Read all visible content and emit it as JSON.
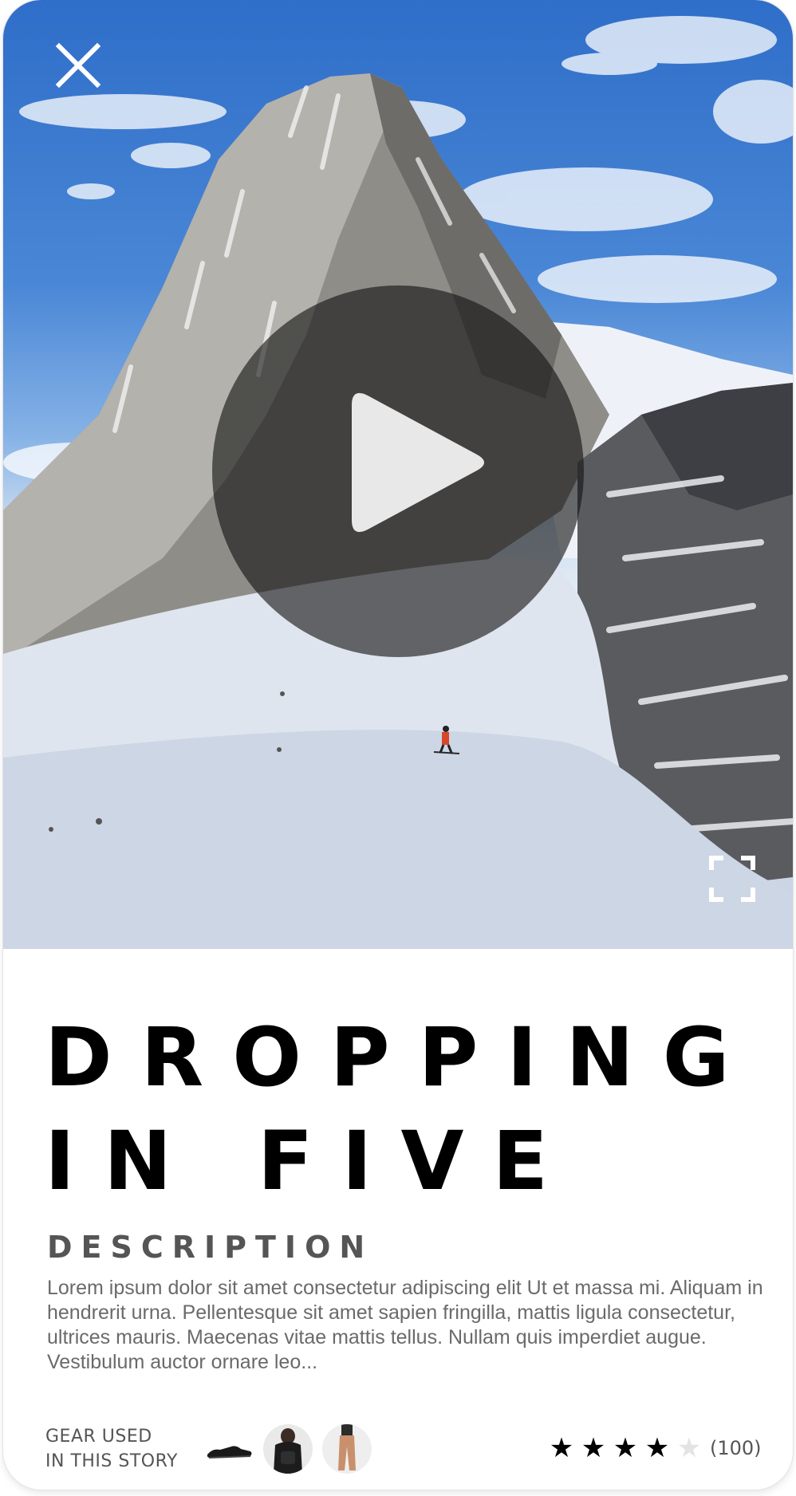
{
  "video": {
    "title_lines": [
      "DROPPING",
      "IN FIVE"
    ],
    "icons": {
      "close": "close-icon",
      "play": "play-icon",
      "fullscreen": "fullscreen-icon"
    }
  },
  "description": {
    "heading": "DESCRIPTION",
    "text": "Lorem ipsum dolor sit amet consectetur adipiscing elit Ut et massa mi. Aliquam in hendrerit urna. Pellentesque sit amet sapien fringilla, mattis ligula consectetur, ultrices mauris. Maecenas vitae mattis tellus. Nullam quis imperdiet augue. Vestibulum auctor ornare leo..."
  },
  "gear": {
    "label_lines": [
      "GEAR USED",
      "IN THIS STORY"
    ],
    "items": [
      {
        "icon": "shoe-icon"
      },
      {
        "icon": "backpack-icon"
      },
      {
        "icon": "pants-icon"
      }
    ]
  },
  "rating": {
    "stars": 4,
    "max": 5,
    "count": "(100)"
  },
  "colors": {
    "title": "#000000",
    "heading": "#555555",
    "body": "#6a6a6a",
    "star_filled": "#000000",
    "star_empty": "#e4e4e4"
  }
}
